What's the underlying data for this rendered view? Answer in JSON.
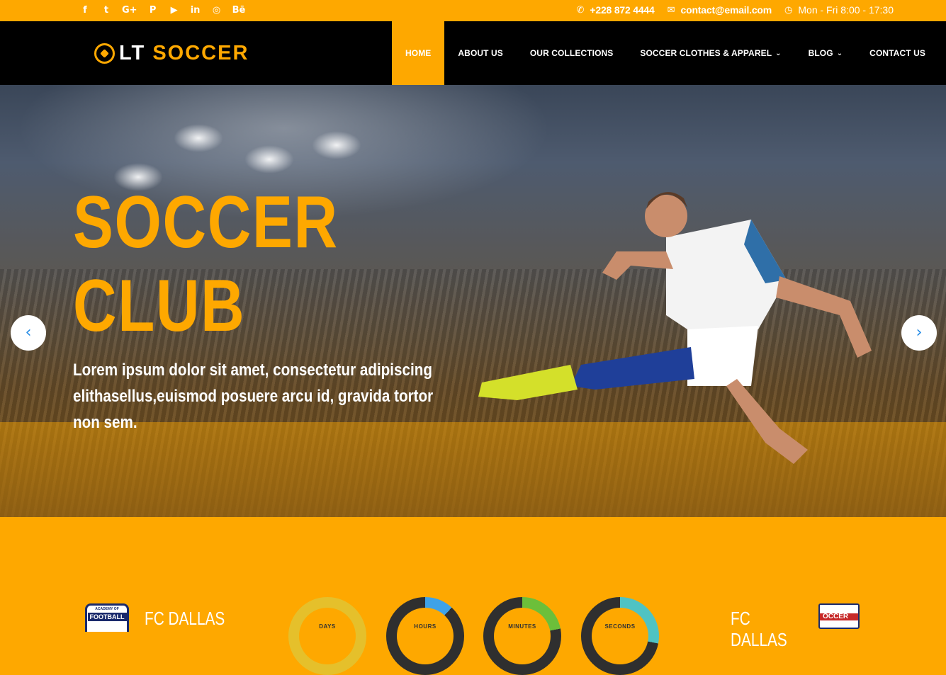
{
  "topbar": {
    "social": [
      {
        "icon": "facebook-icon",
        "glyph": "f"
      },
      {
        "icon": "twitter-icon",
        "glyph": "t"
      },
      {
        "icon": "google-plus-icon",
        "glyph": "G+"
      },
      {
        "icon": "pinterest-icon",
        "glyph": "P"
      },
      {
        "icon": "youtube-icon",
        "glyph": "▶"
      },
      {
        "icon": "linkedin-icon",
        "glyph": "in"
      },
      {
        "icon": "dribbble-icon",
        "glyph": "◎"
      },
      {
        "icon": "behance-icon",
        "glyph": "Bē"
      }
    ],
    "phone": "+228 872 4444",
    "email": "contact@email.com",
    "hours": "Mon - Fri 8:00 - 17:30"
  },
  "header": {
    "logo_main": "LT",
    "logo_accent": "SOCCER",
    "nav": [
      {
        "label": "HOME",
        "active": true,
        "dropdown": false
      },
      {
        "label": "ABOUT US",
        "active": false,
        "dropdown": false
      },
      {
        "label": "OUR COLLECTIONS",
        "active": false,
        "dropdown": false
      },
      {
        "label": "SOCCER CLOTHES & APPAREL",
        "active": false,
        "dropdown": true
      },
      {
        "label": "BLOG",
        "active": false,
        "dropdown": true
      },
      {
        "label": "CONTACT US",
        "active": false,
        "dropdown": false
      }
    ]
  },
  "hero": {
    "title_line1": "SOCCER",
    "title_line2": "CLUB",
    "text": "Lorem ipsum dolor sit amet, consectetur adipiscing elithasellus,euismod posuere arcu id, gravida tortor non sem."
  },
  "countdown": {
    "team_left": "FC DALLAS",
    "team_right": "FC DALLAS",
    "badge_left_top": "ACADEMY OF",
    "badge_left_main": "FOOTBALL",
    "badge_right_text": "OCCER",
    "timers": [
      {
        "label": "DAYS",
        "color": "#e5c02b",
        "fraction": 1.0
      },
      {
        "label": "HOURS",
        "color": "#3ea2e8",
        "fraction": 0.12
      },
      {
        "label": "MINUTES",
        "color": "#6cbf3a",
        "fraction": 0.22
      },
      {
        "label": "SECONDS",
        "color": "#4fc3c3",
        "fraction": 0.28
      }
    ]
  },
  "colors": {
    "accent": "#fea800",
    "header_bg": "#000000"
  }
}
